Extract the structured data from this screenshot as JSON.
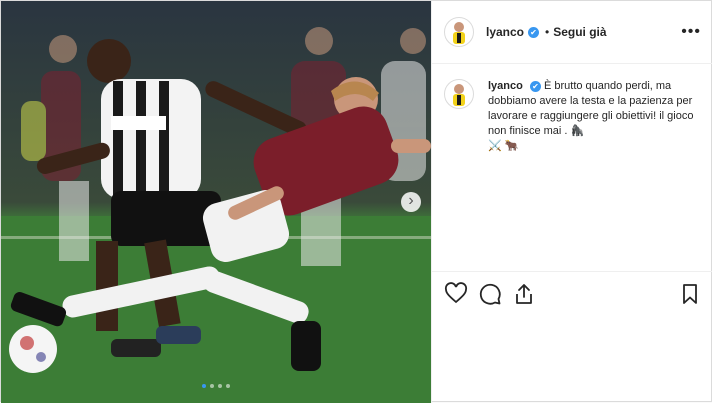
{
  "post": {
    "username": "lyanco",
    "verified_mark": "✔",
    "separator": "•",
    "follow_label": "Segui già",
    "more_label": "•••",
    "caption": {
      "username": "lyanco",
      "text": "È brutto quando perdi, ma dobbiamo avere la testa e la pazienza per lavorare e raggiungere gli obiettivi! il gioco non finisce mai .",
      "emoji_1": "🦍",
      "emoji_2": "⚔️",
      "emoji_3": "🐂"
    },
    "carousel": {
      "next_glyph": "›",
      "slide_count": 4,
      "active_index": 0
    },
    "icons": [
      "heart-icon",
      "comment-icon",
      "share-icon",
      "bookmark-icon"
    ],
    "colors": {
      "accent": "#3897f0",
      "text": "#262626",
      "border": "#efefef"
    }
  }
}
